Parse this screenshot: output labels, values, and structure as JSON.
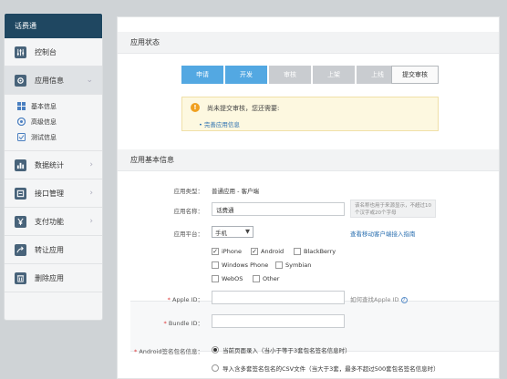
{
  "sidebar": {
    "brand": "话费通",
    "items": [
      {
        "label": "控制台"
      },
      {
        "label": "应用信息"
      },
      {
        "label": "数据统计"
      },
      {
        "label": "接口管理"
      },
      {
        "label": "支付功能"
      },
      {
        "label": "转让应用"
      },
      {
        "label": "删除应用"
      }
    ],
    "subitems": [
      "基本信息",
      "高级信息",
      "测试信息"
    ]
  },
  "status": {
    "title": "应用状态",
    "steps": [
      "申请",
      "开发",
      "审核",
      "上架",
      "上线"
    ],
    "current_step_count": 2,
    "submit_label": "提交审核",
    "alert_title": "尚未提交审核，您还需要:",
    "alert_link": "• 完善应用信息"
  },
  "basic": {
    "title": "应用基本信息",
    "type_label": "应用类型：",
    "type_value": "普通应用 - 客户端",
    "name_label": "应用名称：",
    "name_value": "话费通",
    "name_hint": "该名称也用于来源显示，不超过10个汉字或20个字母",
    "platform_label": "应用平台：",
    "platform_value": "手机",
    "platform_guide": "查看移动客户端接入指南",
    "platforms": [
      {
        "label": "iPhone",
        "checked": true
      },
      {
        "label": "Android",
        "checked": true
      },
      {
        "label": "BlackBerry",
        "checked": false
      },
      {
        "label": "Windows Phone",
        "checked": false
      },
      {
        "label": "Symbian",
        "checked": false
      },
      {
        "label": "WebOS",
        "checked": false
      },
      {
        "label": "Other",
        "checked": false
      }
    ],
    "apple_label": "Apple ID：",
    "apple_value": "",
    "apple_help": "如何查找Apple ID",
    "bundle_label": "Bundle ID：",
    "bundle_value": "",
    "android_label": "Android签名包名信息：",
    "android_opt1": "当前页面录入（当小于等于3套包名签名信息时）",
    "android_opt2": "导入含多套签名包名的CSV文件（当大于3套，最多不超过500套包名签名信息时）"
  },
  "colors": {
    "brand_bg": "#1f4761",
    "step_done": "#53a8e2",
    "step_todo": "#c9ccd0",
    "link": "#2a6fb0"
  }
}
